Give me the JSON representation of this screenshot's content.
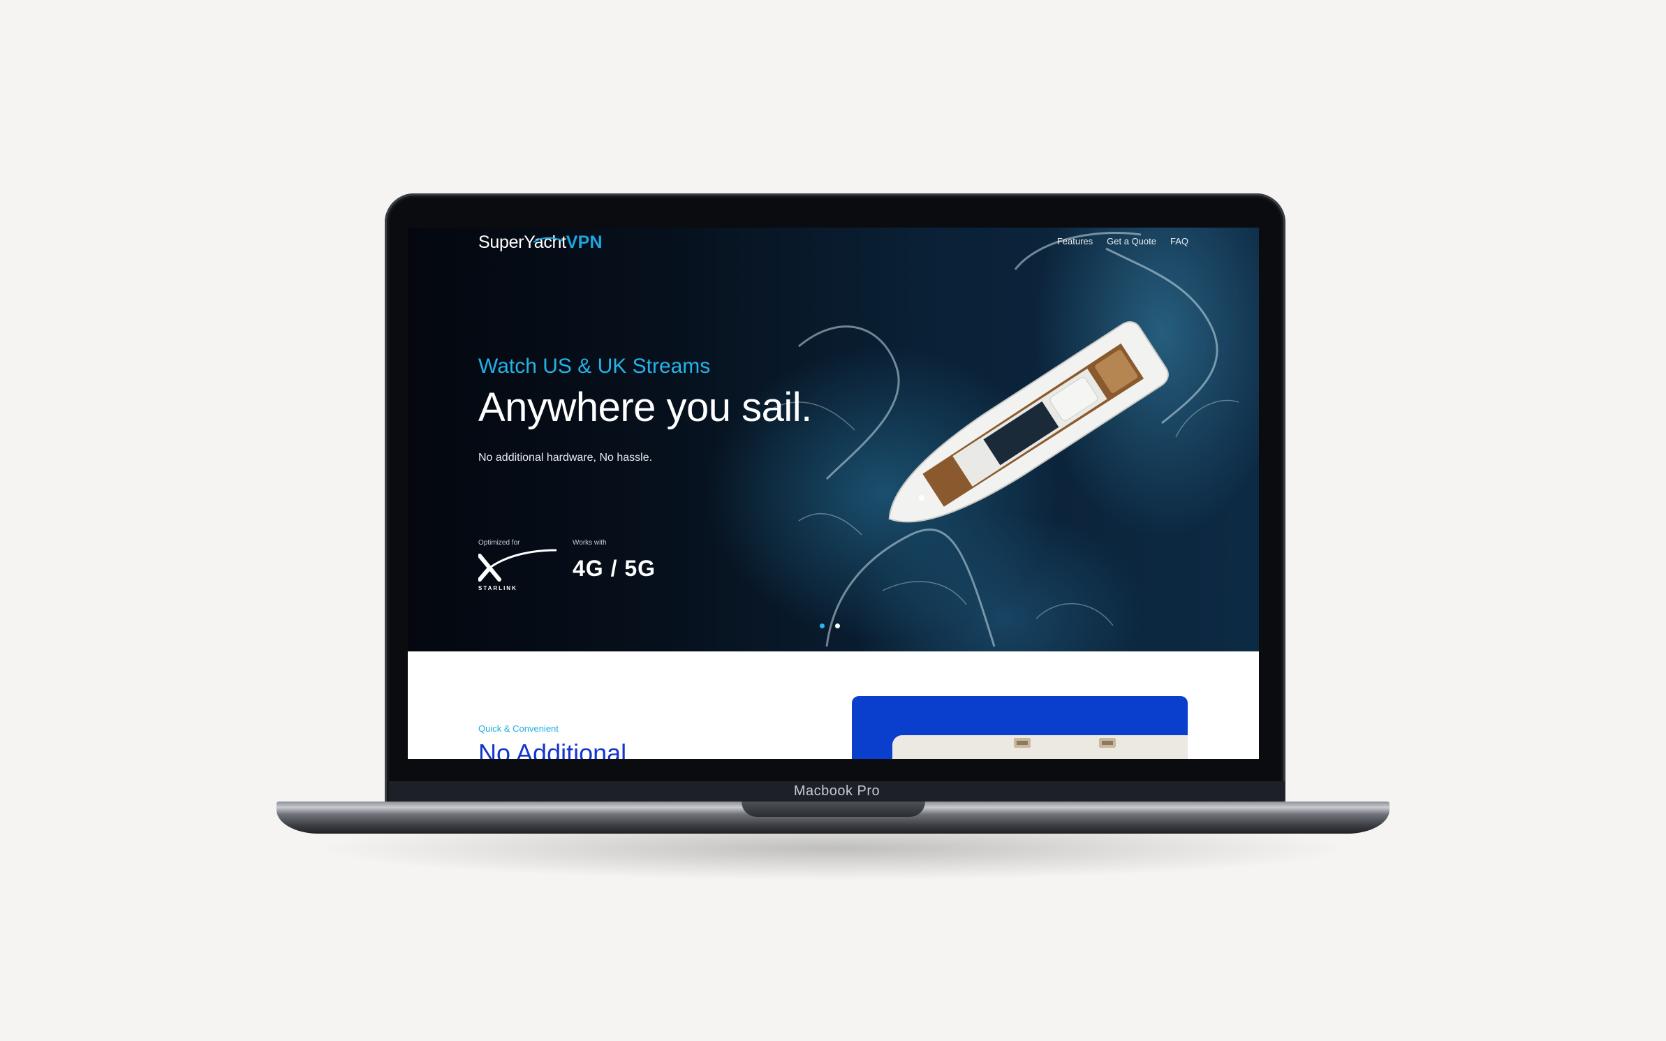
{
  "device": {
    "label": "Macbook Pro"
  },
  "site": {
    "logo": {
      "primary": "SuperYacht",
      "accent": "VPN"
    },
    "nav": [
      {
        "label": "Features"
      },
      {
        "label": "Get a Quote"
      },
      {
        "label": "FAQ"
      }
    ]
  },
  "hero": {
    "eyebrow": "Watch US & UK Streams",
    "headline": "Anywhere you sail.",
    "subline": "No additional hardware, No hassle.",
    "badges": {
      "optimized_caption": "Optimized for",
      "optimized_brand": "STARLINK",
      "works_caption": "Works with",
      "works_value": "4G / 5G"
    },
    "carousel": {
      "slides": 2,
      "active": 1
    }
  },
  "section": {
    "eyebrow": "Quick & Convenient",
    "title": "No Additional"
  },
  "colors": {
    "accent": "#1da6e0",
    "section_title": "#1437c8",
    "promo_card": "#0a3fce",
    "page_bg": "#f5f4f2"
  }
}
